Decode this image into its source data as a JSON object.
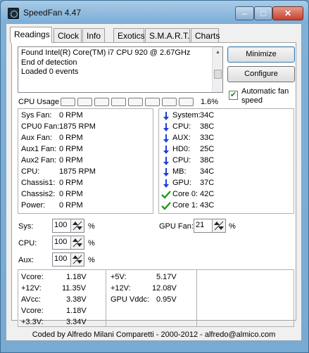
{
  "window": {
    "title": "SpeedFan 4.47"
  },
  "tabs": [
    {
      "label": "Readings"
    },
    {
      "label": "Clock"
    },
    {
      "label": "Info"
    },
    {
      "label": "Exotics"
    },
    {
      "label": "S.M.A.R.T."
    },
    {
      "label": "Charts"
    }
  ],
  "log": {
    "lines": [
      "Found Intel(R) Core(TM) i7 CPU 920 @ 2.67GHz",
      "End of detection",
      "Loaded 0 events"
    ]
  },
  "buttons": {
    "minimize": "Minimize",
    "configure": "Configure"
  },
  "auto_fan": {
    "label_line1": "Automatic fan",
    "label_line2": "speed",
    "checked": true
  },
  "cpu_usage": {
    "label": "CPU Usage",
    "value": "1.6%",
    "cells": 8
  },
  "fans": [
    {
      "label": "Sys Fan:",
      "value": "0 RPM"
    },
    {
      "label": "CPU0 Fan:",
      "value": "1875 RPM"
    },
    {
      "label": "Aux Fan:",
      "value": "0 RPM"
    },
    {
      "label": "Aux1 Fan:",
      "value": "0 RPM"
    },
    {
      "label": "Aux2 Fan:",
      "value": "0 RPM"
    },
    {
      "label": "CPU:",
      "value": "1875 RPM"
    },
    {
      "label": "Chassis1:",
      "value": "0 RPM"
    },
    {
      "label": "Chassis2:",
      "value": "0 RPM"
    },
    {
      "label": "Power:",
      "value": "0 RPM"
    }
  ],
  "temps": [
    {
      "label": "System:",
      "value": "34C",
      "icon": "down-arrow-icon"
    },
    {
      "label": "CPU:",
      "value": "38C",
      "icon": "down-arrow-icon"
    },
    {
      "label": "AUX:",
      "value": "33C",
      "icon": "down-arrow-icon"
    },
    {
      "label": "HD0:",
      "value": "25C",
      "icon": "down-arrow-icon"
    },
    {
      "label": "CPU:",
      "value": "38C",
      "icon": "down-arrow-icon"
    },
    {
      "label": "MB:",
      "value": "34C",
      "icon": "down-arrow-icon"
    },
    {
      "label": "GPU:",
      "value": "37C",
      "icon": "down-arrow-icon"
    },
    {
      "label": "Core 0:",
      "value": "42C",
      "icon": "checkmark-icon"
    },
    {
      "label": "Core 1:",
      "value": "43C",
      "icon": "checkmark-icon"
    }
  ],
  "speeds": [
    {
      "label": "Sys:",
      "value": "100",
      "unit": "%"
    },
    {
      "label": "CPU:",
      "value": "100",
      "unit": "%"
    },
    {
      "label": "Aux:",
      "value": "100",
      "unit": "%"
    }
  ],
  "gpu_fan": {
    "label": "GPU Fan:",
    "value": "21",
    "unit": "%"
  },
  "voltages_left": [
    {
      "label": "Vcore:",
      "value": "1.18V"
    },
    {
      "label": "+12V:",
      "value": "11.35V"
    },
    {
      "label": "AVcc:",
      "value": "3.38V"
    },
    {
      "label": "Vcore:",
      "value": "1.18V"
    },
    {
      "label": "+3.3V:",
      "value": "3.34V"
    }
  ],
  "voltages_right": [
    {
      "label": "+5V:",
      "value": "5.17V"
    },
    {
      "label": "+12V:",
      "value": "12.08V"
    },
    {
      "label": "GPU Vddc:",
      "value": "0.95V"
    }
  ],
  "status": "Coded by Alfredo Milani Comparetti - 2000-2012 - alfredo@almico.com",
  "colors": {
    "arrow": "#1c3fd6",
    "check": "#1f9a1f",
    "titlebar": "#7fb0d8"
  }
}
